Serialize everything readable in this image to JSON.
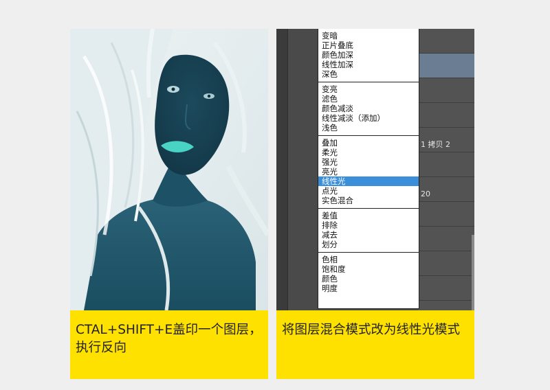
{
  "left": {
    "caption": "CTAL+SHIFT+E盖印一个图层，执行反向"
  },
  "right": {
    "caption": "将图层混合模式改为线性光模式",
    "layer_labels": [
      "1 拷贝 2",
      "20"
    ],
    "menu_groups": [
      [
        "变暗",
        "正片叠底",
        "颜色加深",
        "线性加深",
        "深色"
      ],
      [
        "变亮",
        "滤色",
        "颜色减淡",
        "线性减淡（添加）",
        "浅色"
      ],
      [
        "叠加",
        "柔光",
        "强光",
        "亮光",
        "线性光",
        "点光",
        "实色混合"
      ],
      [
        "差值",
        "排除",
        "减去",
        "划分"
      ],
      [
        "色相",
        "饱和度",
        "颜色",
        "明度"
      ]
    ],
    "selected_item": "线性光"
  },
  "colors": {
    "caption_bg": "#ffe100",
    "menu_highlight": "#3b8fd9",
    "photo_skin": "#1f4f62",
    "photo_hair": "#dfeaec"
  }
}
